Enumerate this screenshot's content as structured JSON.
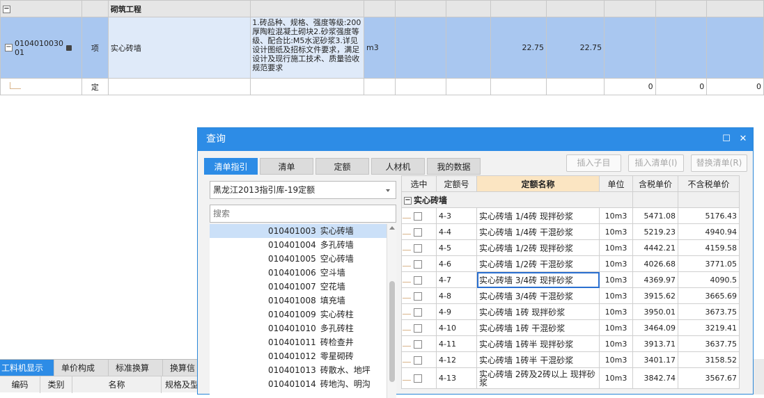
{
  "top_grid": {
    "section_label": "砌筑工程",
    "main_row": {
      "code": "010401003001",
      "type": "项",
      "name": "实心砖墙",
      "description": "1.砖品种、规格、强度等级:200厚陶粒混凝土砌块2.砂浆强度等级、配合比:M5水泥砂浆3.详见设计图纸及招标文件要求，满足设计及现行施工技术、质量验收规范要求",
      "unit": "m3",
      "qty1": "22.75",
      "qty2": "22.75"
    },
    "sub_row": {
      "type": "定",
      "v1": "0",
      "v2": "0",
      "v3": "0"
    }
  },
  "bottom_panel": {
    "tabs": [
      "工料机显示",
      "单价构成",
      "标准换算",
      "换算信"
    ],
    "headers": [
      "编码",
      "类别",
      "名称",
      "规格及型"
    ]
  },
  "dialog": {
    "title": "查询",
    "tabs": [
      "清单指引",
      "清单",
      "定额",
      "人材机",
      "我的数据"
    ],
    "buttons": [
      "插入子目",
      "插入清单(I)",
      "替换清单(R)"
    ],
    "library_select": "黑龙江2013指引库-19定额",
    "search_placeholder": "搜索",
    "list_items": [
      {
        "code": "010401003",
        "name": "实心砖墙"
      },
      {
        "code": "010401004",
        "name": "多孔砖墙"
      },
      {
        "code": "010401005",
        "name": "空心砖墙"
      },
      {
        "code": "010401006",
        "name": "空斗墙"
      },
      {
        "code": "010401007",
        "name": "空花墙"
      },
      {
        "code": "010401008",
        "name": "填充墙"
      },
      {
        "code": "010401009",
        "name": "实心砖柱"
      },
      {
        "code": "010401010",
        "name": "多孔砖柱"
      },
      {
        "code": "010401011",
        "name": "砖检查井"
      },
      {
        "code": "010401012",
        "name": "零星砌砖"
      },
      {
        "code": "010401013",
        "name": "砖散水、地坪"
      },
      {
        "code": "010401014",
        "name": "砖地沟、明沟"
      }
    ],
    "table": {
      "headers": [
        "选中",
        "定额号",
        "定额名称",
        "单位",
        "含税单价",
        "不含税单价"
      ],
      "group": "实心砖墙",
      "rows": [
        {
          "code": "4-3",
          "name": "实心砖墙 1/4砖 现拌砂浆",
          "unit": "10m3",
          "p1": "5471.08",
          "p2": "5176.43"
        },
        {
          "code": "4-4",
          "name": "实心砖墙 1/4砖 干混砂浆",
          "unit": "10m3",
          "p1": "5219.23",
          "p2": "4940.94"
        },
        {
          "code": "4-5",
          "name": "实心砖墙 1/2砖 现拌砂浆",
          "unit": "10m3",
          "p1": "4442.21",
          "p2": "4159.58"
        },
        {
          "code": "4-6",
          "name": "实心砖墙 1/2砖 干混砂浆",
          "unit": "10m3",
          "p1": "4026.68",
          "p2": "3771.05"
        },
        {
          "code": "4-7",
          "name": "实心砖墙 3/4砖 现拌砂浆",
          "unit": "10m3",
          "p1": "4369.97",
          "p2": "4090.5"
        },
        {
          "code": "4-8",
          "name": "实心砖墙 3/4砖 干混砂浆",
          "unit": "10m3",
          "p1": "3915.62",
          "p2": "3665.69"
        },
        {
          "code": "4-9",
          "name": "实心砖墙 1砖 现拌砂浆",
          "unit": "10m3",
          "p1": "3950.01",
          "p2": "3673.75"
        },
        {
          "code": "4-10",
          "name": "实心砖墙 1砖 干混砂浆",
          "unit": "10m3",
          "p1": "3464.09",
          "p2": "3219.41"
        },
        {
          "code": "4-11",
          "name": "实心砖墙 1砖半 现拌砂浆",
          "unit": "10m3",
          "p1": "3913.71",
          "p2": "3637.75"
        },
        {
          "code": "4-12",
          "name": "实心砖墙 1砖半 干混砂浆",
          "unit": "10m3",
          "p1": "3401.17",
          "p2": "3158.52"
        },
        {
          "code": "4-13",
          "name": "实心砖墙 2砖及2砖以上 现拌砂浆",
          "unit": "10m3",
          "p1": "3842.74",
          "p2": "3567.67"
        }
      ]
    }
  }
}
